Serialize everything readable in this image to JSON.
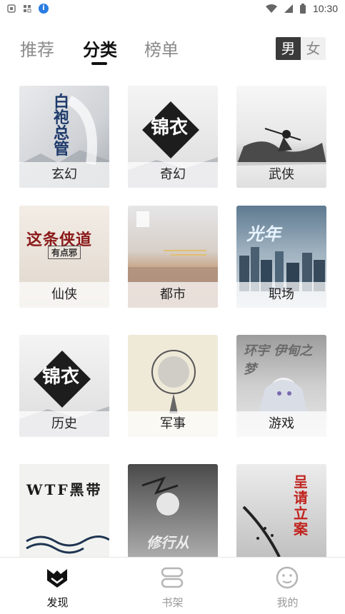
{
  "status_bar": {
    "time": "10:30"
  },
  "top_tabs": [
    {
      "label": "推荐",
      "active": false
    },
    {
      "label": "分类",
      "active": true
    },
    {
      "label": "榜单",
      "active": false
    }
  ],
  "gender_toggle": {
    "male": "男",
    "female": "女",
    "selected": "男"
  },
  "categories": [
    {
      "label": "玄幻",
      "art_text": "白袍总管"
    },
    {
      "label": "奇幻",
      "art_text": "锦衣"
    },
    {
      "label": "武侠",
      "art_text": ""
    },
    {
      "label": "仙侠",
      "art_text": "这条侠道",
      "art_sub": "有点邪"
    },
    {
      "label": "都市",
      "art_text": ""
    },
    {
      "label": "职场",
      "art_text": "光年"
    },
    {
      "label": "历史",
      "art_text": "锦衣"
    },
    {
      "label": "军事",
      "art_text": ""
    },
    {
      "label": "游戏",
      "art_text": "环宇 伊甸之梦"
    },
    {
      "label": "",
      "art_text": "WTF黑带"
    },
    {
      "label": "",
      "art_text": "修行从"
    },
    {
      "label": "",
      "art_text": "呈请立案"
    }
  ],
  "bottom_nav": [
    {
      "label": "发现",
      "icon": "discover-icon",
      "active": true
    },
    {
      "label": "书架",
      "icon": "bookshelf-icon",
      "active": false
    },
    {
      "label": "我的",
      "icon": "profile-icon",
      "active": false
    }
  ],
  "colors": {
    "active_text": "#111111",
    "inactive_text": "#8a8a8a",
    "accent_dark": "#3a3a3a"
  }
}
